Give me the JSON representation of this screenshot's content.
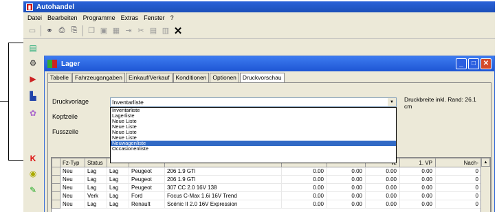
{
  "app": {
    "title": "Autohandel"
  },
  "menu": [
    "Datei",
    "Bearbeiten",
    "Programme",
    "Extras",
    "Fenster",
    "?"
  ],
  "toolbar": {
    "icons": [
      "new-icon",
      "binoculars-icon",
      "print-icon",
      "print-preview-icon",
      "copy-icon",
      "save-icon",
      "grid-icon",
      "insert-icon",
      "cut-icon",
      "paste-icon",
      "clipboard-icon",
      "close-icon"
    ]
  },
  "sidebar": {
    "icons": [
      "report-icon",
      "settings-icon",
      "truck-icon",
      "chart-icon",
      "gift-icon",
      "close-icon",
      "car-icon",
      "pen-icon"
    ]
  },
  "child": {
    "title": "Lager"
  },
  "tabs": [
    "Tabelle",
    "Fahrzeugangaben",
    "Einkauf/Verkauf",
    "Konditionen",
    "Optionen",
    "Druckvorschau"
  ],
  "form": {
    "druckvorlage_label": "Druckvorlage",
    "kopfzeile_label": "Kopfzeile",
    "fusszeile_label": "Fusszeile",
    "combo_value": "Inventarliste",
    "right_note": "Druckbreite inkl. Rand: 26.1 cm",
    "options": [
      "Inventarliste",
      "Lagerliste",
      "Neue Liste",
      "Neue Liste",
      "Neue Liste",
      "Neue Liste",
      "Neuwagenliste",
      "Occasionenliste"
    ],
    "selected_option_index": 6
  },
  "grid": {
    "headers": [
      "",
      "Fz-Typ",
      "Status",
      "",
      "",
      "",
      "",
      "",
      "w.",
      "1. VP",
      "Nach-"
    ],
    "rows": [
      [
        "",
        "Neu",
        "Lag",
        "Lag",
        "Peugeot",
        "206 1.9 GTi",
        "0.00",
        "0.00",
        "0.00",
        "0.00",
        "0"
      ],
      [
        "",
        "Neu",
        "Lag",
        "Lag",
        "Peugeot",
        "206 1.9 GTi",
        "0.00",
        "0.00",
        "0.00",
        "0.00",
        "0"
      ],
      [
        "",
        "Neu",
        "Lag",
        "Lag",
        "Peugeot",
        "307 CC 2.0 16V 138",
        "0.00",
        "0.00",
        "0.00",
        "0.00",
        "0"
      ],
      [
        "",
        "Neu",
        "Verk",
        "Lag",
        "Ford",
        "Focus C-Max 1.6i 16V Trend",
        "0.00",
        "0.00",
        "0.00",
        "0.00",
        "0"
      ],
      [
        "",
        "Neu",
        "Lag",
        "Lag",
        "Renault",
        "Scénic II 2.0 16V Expression",
        "0.00",
        "0.00",
        "0.00",
        "0.00",
        "0"
      ]
    ]
  }
}
